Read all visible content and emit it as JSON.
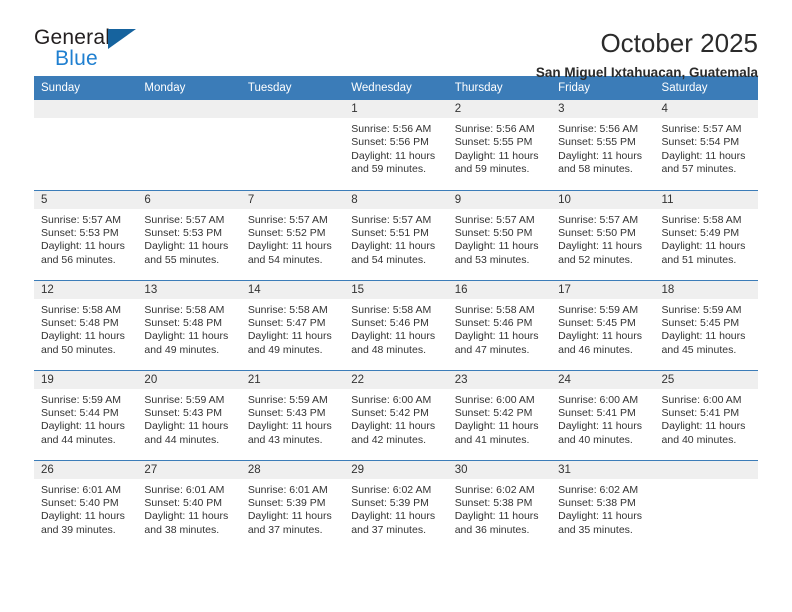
{
  "logo": {
    "primary_text": "General",
    "secondary_text": "Blue",
    "triangle_color": "#16639e",
    "secondary_color": "#1f7fd0"
  },
  "header": {
    "title": "October 2025",
    "subtitle": "San Miguel Ixtahuacan, Guatemala"
  },
  "theme": {
    "header_blue": "#3b7cb8",
    "daynum_band": "#efefef",
    "text": "#333333"
  },
  "weekday_headers": [
    "Sunday",
    "Monday",
    "Tuesday",
    "Wednesday",
    "Thursday",
    "Friday",
    "Saturday"
  ],
  "weeks": [
    [
      {
        "day": "",
        "sunrise": "",
        "sunset": "",
        "daylight_line1": "",
        "daylight_line2": "",
        "empty": true
      },
      {
        "day": "",
        "sunrise": "",
        "sunset": "",
        "daylight_line1": "",
        "daylight_line2": "",
        "empty": true
      },
      {
        "day": "",
        "sunrise": "",
        "sunset": "",
        "daylight_line1": "",
        "daylight_line2": "",
        "empty": true
      },
      {
        "day": "1",
        "sunrise": "Sunrise: 5:56 AM",
        "sunset": "Sunset: 5:56 PM",
        "daylight_line1": "Daylight: 11 hours",
        "daylight_line2": "and 59 minutes.",
        "empty": false
      },
      {
        "day": "2",
        "sunrise": "Sunrise: 5:56 AM",
        "sunset": "Sunset: 5:55 PM",
        "daylight_line1": "Daylight: 11 hours",
        "daylight_line2": "and 59 minutes.",
        "empty": false
      },
      {
        "day": "3",
        "sunrise": "Sunrise: 5:56 AM",
        "sunset": "Sunset: 5:55 PM",
        "daylight_line1": "Daylight: 11 hours",
        "daylight_line2": "and 58 minutes.",
        "empty": false
      },
      {
        "day": "4",
        "sunrise": "Sunrise: 5:57 AM",
        "sunset": "Sunset: 5:54 PM",
        "daylight_line1": "Daylight: 11 hours",
        "daylight_line2": "and 57 minutes.",
        "empty": false
      }
    ],
    [
      {
        "day": "5",
        "sunrise": "Sunrise: 5:57 AM",
        "sunset": "Sunset: 5:53 PM",
        "daylight_line1": "Daylight: 11 hours",
        "daylight_line2": "and 56 minutes.",
        "empty": false
      },
      {
        "day": "6",
        "sunrise": "Sunrise: 5:57 AM",
        "sunset": "Sunset: 5:53 PM",
        "daylight_line1": "Daylight: 11 hours",
        "daylight_line2": "and 55 minutes.",
        "empty": false
      },
      {
        "day": "7",
        "sunrise": "Sunrise: 5:57 AM",
        "sunset": "Sunset: 5:52 PM",
        "daylight_line1": "Daylight: 11 hours",
        "daylight_line2": "and 54 minutes.",
        "empty": false
      },
      {
        "day": "8",
        "sunrise": "Sunrise: 5:57 AM",
        "sunset": "Sunset: 5:51 PM",
        "daylight_line1": "Daylight: 11 hours",
        "daylight_line2": "and 54 minutes.",
        "empty": false
      },
      {
        "day": "9",
        "sunrise": "Sunrise: 5:57 AM",
        "sunset": "Sunset: 5:50 PM",
        "daylight_line1": "Daylight: 11 hours",
        "daylight_line2": "and 53 minutes.",
        "empty": false
      },
      {
        "day": "10",
        "sunrise": "Sunrise: 5:57 AM",
        "sunset": "Sunset: 5:50 PM",
        "daylight_line1": "Daylight: 11 hours",
        "daylight_line2": "and 52 minutes.",
        "empty": false
      },
      {
        "day": "11",
        "sunrise": "Sunrise: 5:58 AM",
        "sunset": "Sunset: 5:49 PM",
        "daylight_line1": "Daylight: 11 hours",
        "daylight_line2": "and 51 minutes.",
        "empty": false
      }
    ],
    [
      {
        "day": "12",
        "sunrise": "Sunrise: 5:58 AM",
        "sunset": "Sunset: 5:48 PM",
        "daylight_line1": "Daylight: 11 hours",
        "daylight_line2": "and 50 minutes.",
        "empty": false
      },
      {
        "day": "13",
        "sunrise": "Sunrise: 5:58 AM",
        "sunset": "Sunset: 5:48 PM",
        "daylight_line1": "Daylight: 11 hours",
        "daylight_line2": "and 49 minutes.",
        "empty": false
      },
      {
        "day": "14",
        "sunrise": "Sunrise: 5:58 AM",
        "sunset": "Sunset: 5:47 PM",
        "daylight_line1": "Daylight: 11 hours",
        "daylight_line2": "and 49 minutes.",
        "empty": false
      },
      {
        "day": "15",
        "sunrise": "Sunrise: 5:58 AM",
        "sunset": "Sunset: 5:46 PM",
        "daylight_line1": "Daylight: 11 hours",
        "daylight_line2": "and 48 minutes.",
        "empty": false
      },
      {
        "day": "16",
        "sunrise": "Sunrise: 5:58 AM",
        "sunset": "Sunset: 5:46 PM",
        "daylight_line1": "Daylight: 11 hours",
        "daylight_line2": "and 47 minutes.",
        "empty": false
      },
      {
        "day": "17",
        "sunrise": "Sunrise: 5:59 AM",
        "sunset": "Sunset: 5:45 PM",
        "daylight_line1": "Daylight: 11 hours",
        "daylight_line2": "and 46 minutes.",
        "empty": false
      },
      {
        "day": "18",
        "sunrise": "Sunrise: 5:59 AM",
        "sunset": "Sunset: 5:45 PM",
        "daylight_line1": "Daylight: 11 hours",
        "daylight_line2": "and 45 minutes.",
        "empty": false
      }
    ],
    [
      {
        "day": "19",
        "sunrise": "Sunrise: 5:59 AM",
        "sunset": "Sunset: 5:44 PM",
        "daylight_line1": "Daylight: 11 hours",
        "daylight_line2": "and 44 minutes.",
        "empty": false
      },
      {
        "day": "20",
        "sunrise": "Sunrise: 5:59 AM",
        "sunset": "Sunset: 5:43 PM",
        "daylight_line1": "Daylight: 11 hours",
        "daylight_line2": "and 44 minutes.",
        "empty": false
      },
      {
        "day": "21",
        "sunrise": "Sunrise: 5:59 AM",
        "sunset": "Sunset: 5:43 PM",
        "daylight_line1": "Daylight: 11 hours",
        "daylight_line2": "and 43 minutes.",
        "empty": false
      },
      {
        "day": "22",
        "sunrise": "Sunrise: 6:00 AM",
        "sunset": "Sunset: 5:42 PM",
        "daylight_line1": "Daylight: 11 hours",
        "daylight_line2": "and 42 minutes.",
        "empty": false
      },
      {
        "day": "23",
        "sunrise": "Sunrise: 6:00 AM",
        "sunset": "Sunset: 5:42 PM",
        "daylight_line1": "Daylight: 11 hours",
        "daylight_line2": "and 41 minutes.",
        "empty": false
      },
      {
        "day": "24",
        "sunrise": "Sunrise: 6:00 AM",
        "sunset": "Sunset: 5:41 PM",
        "daylight_line1": "Daylight: 11 hours",
        "daylight_line2": "and 40 minutes.",
        "empty": false
      },
      {
        "day": "25",
        "sunrise": "Sunrise: 6:00 AM",
        "sunset": "Sunset: 5:41 PM",
        "daylight_line1": "Daylight: 11 hours",
        "daylight_line2": "and 40 minutes.",
        "empty": false
      }
    ],
    [
      {
        "day": "26",
        "sunrise": "Sunrise: 6:01 AM",
        "sunset": "Sunset: 5:40 PM",
        "daylight_line1": "Daylight: 11 hours",
        "daylight_line2": "and 39 minutes.",
        "empty": false
      },
      {
        "day": "27",
        "sunrise": "Sunrise: 6:01 AM",
        "sunset": "Sunset: 5:40 PM",
        "daylight_line1": "Daylight: 11 hours",
        "daylight_line2": "and 38 minutes.",
        "empty": false
      },
      {
        "day": "28",
        "sunrise": "Sunrise: 6:01 AM",
        "sunset": "Sunset: 5:39 PM",
        "daylight_line1": "Daylight: 11 hours",
        "daylight_line2": "and 37 minutes.",
        "empty": false
      },
      {
        "day": "29",
        "sunrise": "Sunrise: 6:02 AM",
        "sunset": "Sunset: 5:39 PM",
        "daylight_line1": "Daylight: 11 hours",
        "daylight_line2": "and 37 minutes.",
        "empty": false
      },
      {
        "day": "30",
        "sunrise": "Sunrise: 6:02 AM",
        "sunset": "Sunset: 5:38 PM",
        "daylight_line1": "Daylight: 11 hours",
        "daylight_line2": "and 36 minutes.",
        "empty": false
      },
      {
        "day": "31",
        "sunrise": "Sunrise: 6:02 AM",
        "sunset": "Sunset: 5:38 PM",
        "daylight_line1": "Daylight: 11 hours",
        "daylight_line2": "and 35 minutes.",
        "empty": false
      },
      {
        "day": "",
        "sunrise": "",
        "sunset": "",
        "daylight_line1": "",
        "daylight_line2": "",
        "empty": true
      }
    ]
  ]
}
